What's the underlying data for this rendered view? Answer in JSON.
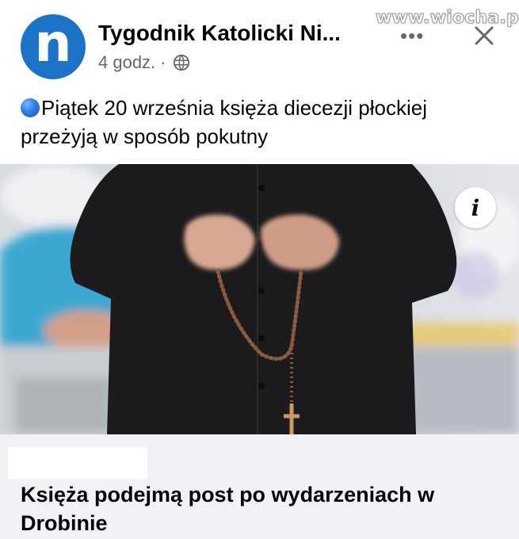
{
  "post": {
    "page_name": "Tygodnik Katolicki Ni...",
    "avatar_letter": "n",
    "time": "4 godz.",
    "separator": "·",
    "privacy_icon": "globe-icon",
    "more_label": "•••",
    "close_label": "✕",
    "caption": "Piątek 20 września księża diecezji płockiej przeżyją w sposób pokutny",
    "caption_icon": "blue-circle-emoji",
    "info_label": "i"
  },
  "link_preview": {
    "title": "Księża podejmą post po wydarzeniach w Drobinie"
  },
  "watermark": {
    "text": "www.wiocha.pl"
  },
  "colors": {
    "avatar_bg": "#1a73c7",
    "text_primary": "#050505",
    "text_secondary": "#65676b",
    "link_bg": "#f0f2f5"
  }
}
